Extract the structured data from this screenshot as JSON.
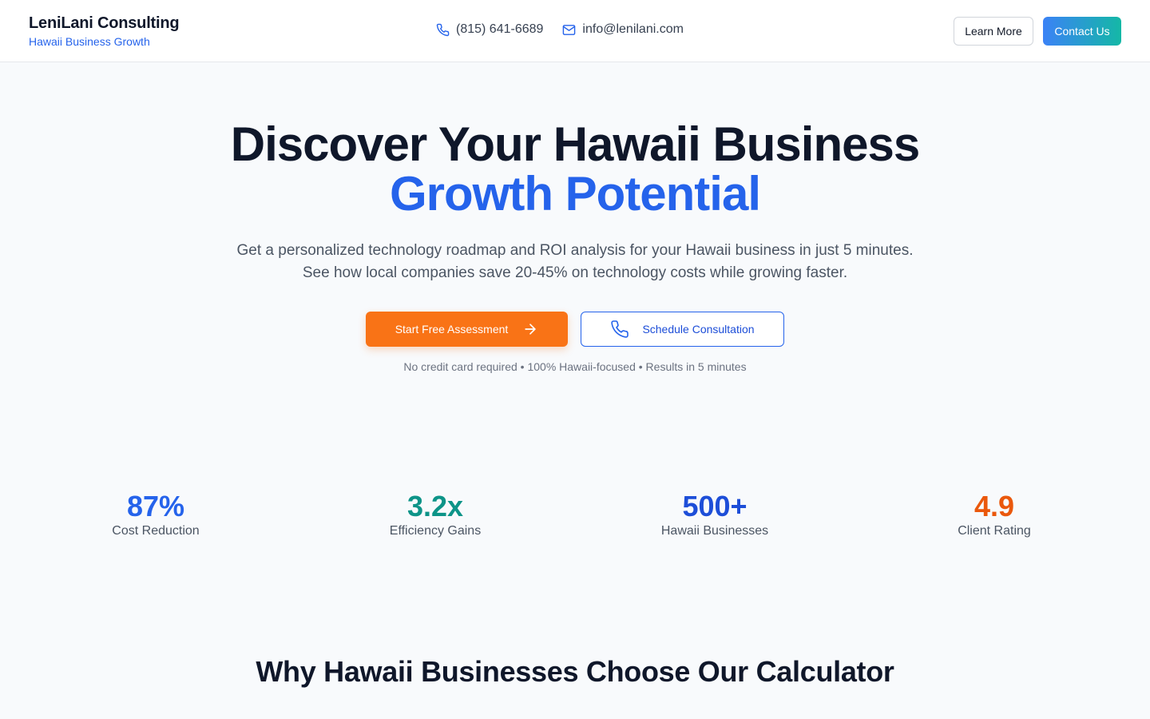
{
  "header": {
    "brand_name": "LeniLani Consulting",
    "brand_tagline": "Hawaii Business Growth",
    "phone": "(815) 641-6689",
    "email": "info@lenilani.com",
    "learn_more_label": "Learn More",
    "contact_label": "Contact Us"
  },
  "hero": {
    "title_line1": "Discover Your Hawaii Business",
    "title_line2": "Growth Potential",
    "subtitle_line1": "Get a personalized technology roadmap and ROI analysis for your Hawaii business in just 5 minutes.",
    "subtitle_line2": "See how local companies save 20-45% on technology costs while growing faster.",
    "start_label": "Start Free Assessment",
    "schedule_label": "Schedule Consultation",
    "note": "No credit card required • 100% Hawaii-focused • Results in 5 minutes"
  },
  "stats": [
    {
      "value": "87%",
      "label": "Cost Reduction",
      "color": "#2563eb"
    },
    {
      "value": "3.2x",
      "label": "Efficiency Gains",
      "color": "#0d9488"
    },
    {
      "value": "500+",
      "label": "Hawaii Businesses",
      "color": "#1d4ed8"
    },
    {
      "value": "4.9",
      "label": "Client Rating",
      "color": "#ea580c"
    }
  ],
  "why_title": "Why Hawaii Businesses Choose Our Calculator",
  "colors": {
    "primary": "#2563eb",
    "orange": "#f97316",
    "teal": "#14b8a6"
  },
  "icons": {
    "phone": "phone-icon",
    "email": "mail-icon",
    "arrow": "arrow-right-icon"
  }
}
